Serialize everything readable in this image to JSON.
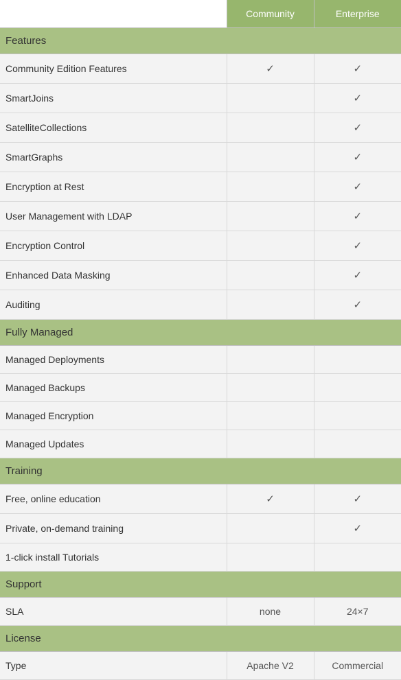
{
  "columns": [
    "Community",
    "Enterprise"
  ],
  "check_glyph": "✓",
  "sections": [
    {
      "title": "Features",
      "rows": [
        {
          "label": "Community Edition Features",
          "cells": [
            "check",
            "check"
          ]
        },
        {
          "label": "SmartJoins",
          "cells": [
            "",
            "check"
          ]
        },
        {
          "label": "SatelliteCollections",
          "cells": [
            "",
            "check"
          ]
        },
        {
          "label": "SmartGraphs",
          "cells": [
            "",
            "check"
          ]
        },
        {
          "label": "Encryption at Rest",
          "cells": [
            "",
            "check"
          ]
        },
        {
          "label": "User Management with LDAP",
          "cells": [
            "",
            "check"
          ]
        },
        {
          "label": "Encryption Control",
          "cells": [
            "",
            "check"
          ]
        },
        {
          "label": "Enhanced Data Masking",
          "cells": [
            "",
            "check"
          ]
        },
        {
          "label": "Auditing",
          "cells": [
            "",
            "check"
          ]
        }
      ]
    },
    {
      "title": "Fully Managed",
      "rows": [
        {
          "label": "Managed Deployments",
          "cells": [
            "",
            ""
          ]
        },
        {
          "label": "Managed Backups",
          "cells": [
            "",
            ""
          ]
        },
        {
          "label": "Managed Encryption",
          "cells": [
            "",
            ""
          ]
        },
        {
          "label": "Managed Updates",
          "cells": [
            "",
            ""
          ]
        }
      ]
    },
    {
      "title": "Training",
      "rows": [
        {
          "label": "Free, online education",
          "cells": [
            "check",
            "check"
          ]
        },
        {
          "label": "Private, on-demand training",
          "cells": [
            "",
            "check"
          ]
        },
        {
          "label": "1-click install Tutorials",
          "cells": [
            "",
            ""
          ]
        }
      ]
    },
    {
      "title": "Support",
      "rows": [
        {
          "label": "SLA",
          "cells": [
            "none",
            "24×7"
          ]
        }
      ]
    },
    {
      "title": "License",
      "rows": [
        {
          "label": "Type",
          "cells": [
            "Apache V2",
            "Commercial"
          ]
        }
      ]
    }
  ],
  "chart_data": {
    "type": "table",
    "title": "Feature comparison",
    "columns": [
      "Community",
      "Enterprise"
    ],
    "sections": {
      "Features": {
        "Community Edition Features": {
          "Community": true,
          "Enterprise": true
        },
        "SmartJoins": {
          "Community": false,
          "Enterprise": true
        },
        "SatelliteCollections": {
          "Community": false,
          "Enterprise": true
        },
        "SmartGraphs": {
          "Community": false,
          "Enterprise": true
        },
        "Encryption at Rest": {
          "Community": false,
          "Enterprise": true
        },
        "User Management with LDAP": {
          "Community": false,
          "Enterprise": true
        },
        "Encryption Control": {
          "Community": false,
          "Enterprise": true
        },
        "Enhanced Data Masking": {
          "Community": false,
          "Enterprise": true
        },
        "Auditing": {
          "Community": false,
          "Enterprise": true
        }
      },
      "Fully Managed": {
        "Managed Deployments": {
          "Community": null,
          "Enterprise": null
        },
        "Managed Backups": {
          "Community": null,
          "Enterprise": null
        },
        "Managed Encryption": {
          "Community": null,
          "Enterprise": null
        },
        "Managed Updates": {
          "Community": null,
          "Enterprise": null
        }
      },
      "Training": {
        "Free, online education": {
          "Community": true,
          "Enterprise": true
        },
        "Private, on-demand training": {
          "Community": false,
          "Enterprise": true
        },
        "1-click install Tutorials": {
          "Community": null,
          "Enterprise": null
        }
      },
      "Support": {
        "SLA": {
          "Community": "none",
          "Enterprise": "24×7"
        }
      },
      "License": {
        "Type": {
          "Community": "Apache V2",
          "Enterprise": "Commercial"
        }
      }
    }
  }
}
